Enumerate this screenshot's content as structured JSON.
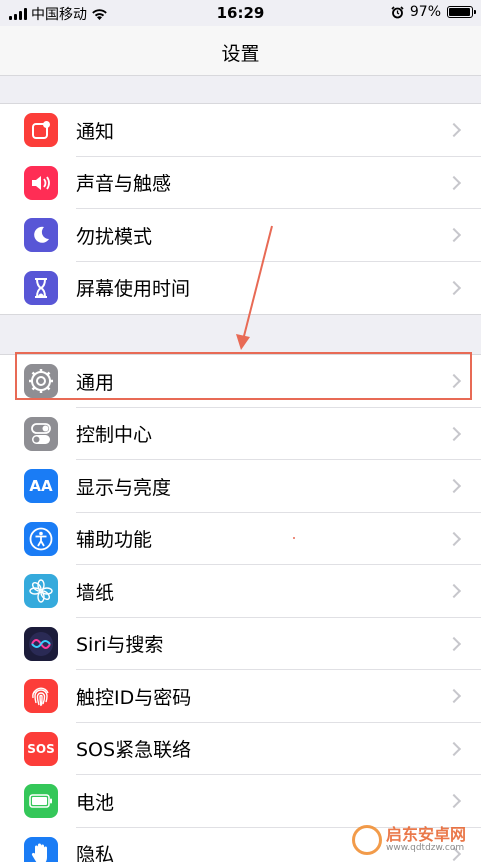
{
  "status_bar": {
    "carrier": "中国移动",
    "time": "16:29",
    "battery": "97%",
    "battery_level": 0.97
  },
  "nav": {
    "title": "设置"
  },
  "group1": [
    {
      "label": "通知",
      "icon": "notifications-icon",
      "color": "#fc3d39"
    },
    {
      "label": "声音与触感",
      "icon": "sound-icon",
      "color": "#ff2d55"
    },
    {
      "label": "勿扰模式",
      "icon": "moon-icon",
      "color": "#5856d6"
    },
    {
      "label": "屏幕使用时间",
      "icon": "hourglass-icon",
      "color": "#5856d6"
    }
  ],
  "group2": [
    {
      "label": "通用",
      "icon": "gear-icon",
      "color": "#8e8e93"
    },
    {
      "label": "控制中心",
      "icon": "toggles-icon",
      "color": "#8e8e93"
    },
    {
      "label": "显示与亮度",
      "icon": "display-icon",
      "icon_text": "AA",
      "color": "#1a7cf5"
    },
    {
      "label": "辅助功能",
      "icon": "accessibility-icon",
      "color": "#1a7cf5"
    },
    {
      "label": "墙纸",
      "icon": "wallpaper-icon",
      "color": "#35aadc"
    },
    {
      "label": "Siri与搜索",
      "icon": "siri-icon",
      "color": "#1c1c3a"
    },
    {
      "label": "触控ID与密码",
      "icon": "fingerprint-icon",
      "color": "#fc3d39"
    },
    {
      "label": "SOS紧急联络",
      "icon": "sos-icon",
      "icon_text": "SOS",
      "color": "#fc3d39"
    },
    {
      "label": "电池",
      "icon": "battery-icon",
      "color": "#34c759"
    },
    {
      "label": "隐私",
      "icon": "hand-icon",
      "color": "#1a7cf5"
    }
  ],
  "annotation": {
    "color": "#e86a55"
  },
  "watermark": {
    "title": "启东安卓网",
    "url": "www.qdtdzw.com"
  }
}
